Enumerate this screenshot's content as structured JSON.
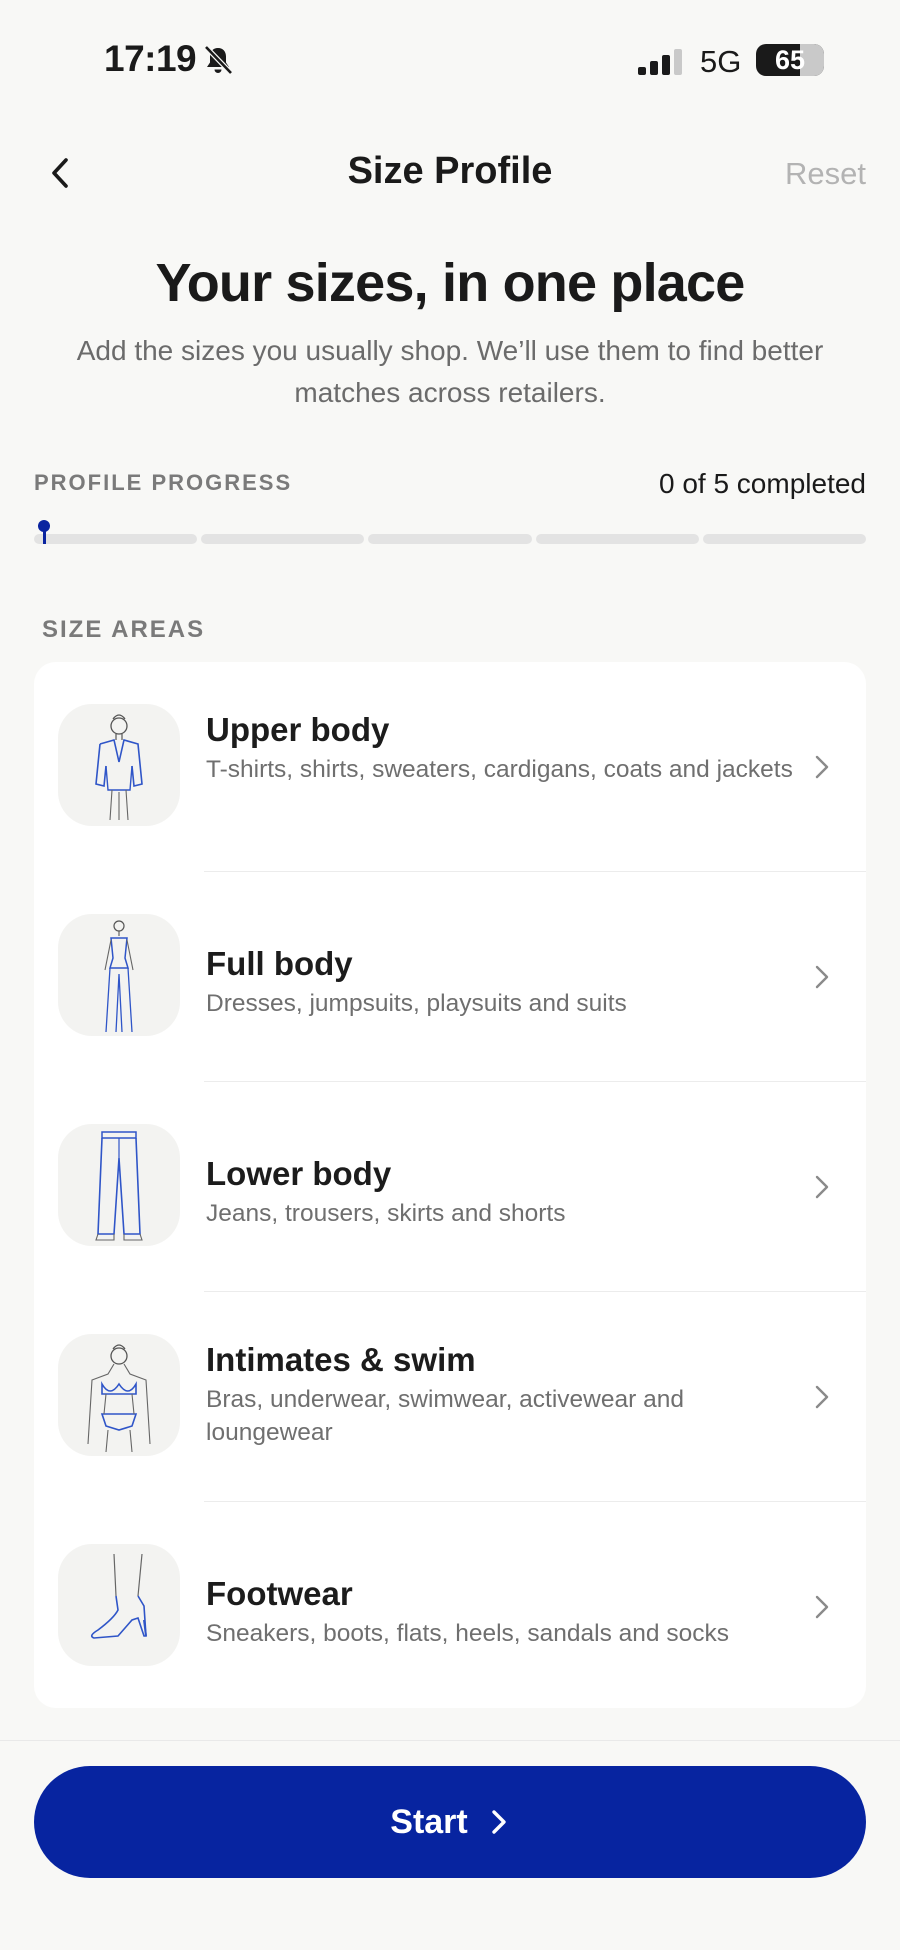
{
  "status_bar": {
    "time": "17:19",
    "network": "5G",
    "battery": "65",
    "battery_level": 0.65,
    "icons": [
      "bell-slash-icon",
      "cellular-signal-icon",
      "battery-icon"
    ]
  },
  "nav": {
    "title": "Size Profile",
    "reset_label": "Reset",
    "back_icon": "chevron-left-icon"
  },
  "hero": {
    "title": "Your sizes, in one place",
    "subtitle": "Add the sizes you usually shop. We’ll use them to find better matches across retailers."
  },
  "progress": {
    "label": "PROFILE PROGRESS",
    "count_text": "0 of 5 completed",
    "completed": 0,
    "total": 5
  },
  "section": {
    "label": "SIZE AREAS",
    "items": [
      {
        "title": "Upper body",
        "description": "T-shirts, shirts, sweaters, cardigans, coats and jackets",
        "icon": "upper-body-illustration-icon"
      },
      {
        "title": "Full body",
        "description": "Dresses, jumpsuits, playsuits and suits",
        "icon": "full-body-illustration-icon"
      },
      {
        "title": "Lower body",
        "description": "Jeans, trousers, skirts and shorts",
        "icon": "lower-body-illustration-icon"
      },
      {
        "title": "Intimates & swim",
        "description": "Bras, underwear, swimwear, activewear and loungewear",
        "icon": "intimates-illustration-icon"
      },
      {
        "title": "Footwear",
        "description": "Sneakers, boots, flats, heels, sandals and socks",
        "icon": "footwear-illustration-icon"
      }
    ]
  },
  "cta": {
    "label": "Start",
    "icon": "chevron-right-icon"
  },
  "colors": {
    "accent": "#0724a0",
    "background": "#f8f8f6",
    "card": "#ffffff",
    "muted_text": "#6f6f6f",
    "disabled_text": "#b3b3b3"
  }
}
